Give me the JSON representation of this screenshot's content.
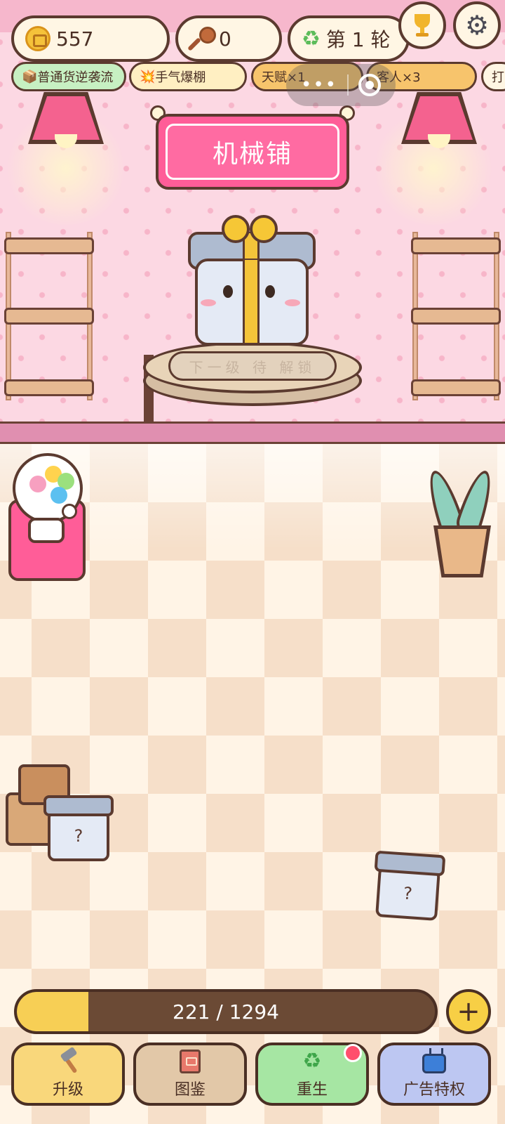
{
  "status": {
    "coins": "557",
    "keys": "0",
    "round": "第 1 轮"
  },
  "perks": [
    {
      "icon": "📦",
      "label": "普通货逆袭流",
      "color": "#c7f0c2"
    },
    {
      "icon": "💥",
      "label": "手气爆棚",
      "color": "#ffefc2"
    },
    {
      "icon": "",
      "label": "天赋×1",
      "color": "#f7c46c"
    },
    {
      "icon": "",
      "label": "客人×3",
      "color": "#f7c46c"
    },
    {
      "icon": "",
      "label": "打",
      "color": "#fff6e4"
    }
  ],
  "shop": {
    "name": "机械铺",
    "next_level_hint": "下一级 待 解锁"
  },
  "mystery_boxes": [
    {
      "label": "?"
    },
    {
      "label": "?"
    }
  ],
  "progress": {
    "current": 221,
    "max": 1294,
    "text": "221 / 1294",
    "fraction": 0.171,
    "plus_label": "+"
  },
  "nav": [
    {
      "label": "升级",
      "icon": "hammer-icon",
      "color": "#f9d77b"
    },
    {
      "label": "图鉴",
      "icon": "book-icon",
      "color": "#e2c8a8"
    },
    {
      "label": "重生",
      "icon": "recycle-icon",
      "color": "#a6e6a3",
      "badge": true
    },
    {
      "label": "广告特权",
      "icon": "tv-icon",
      "color": "#bdc7f2"
    }
  ],
  "icons": {
    "recycle": "♻",
    "gear": "⚙",
    "capsule_dots": "•••"
  },
  "colors": {
    "accent_pink": "#ff5d98",
    "progress_fill": "#f7cf55",
    "outline": "#5b3a2f"
  }
}
